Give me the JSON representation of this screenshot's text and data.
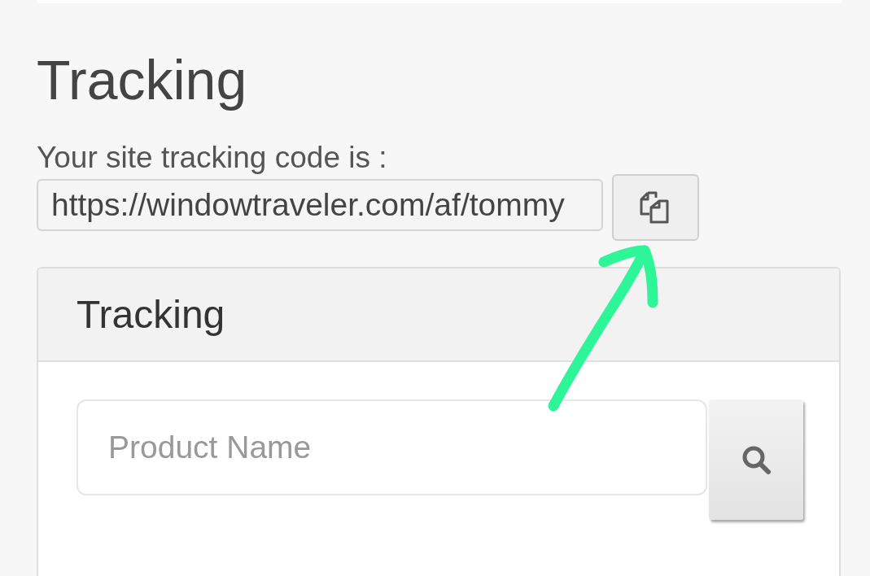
{
  "heading": "Tracking",
  "tracking_code": {
    "label": "Your site tracking code is :",
    "value": "https://windowtraveler.com/af/tommy"
  },
  "panel": {
    "title": "Tracking",
    "search": {
      "placeholder": "Product Name"
    }
  }
}
